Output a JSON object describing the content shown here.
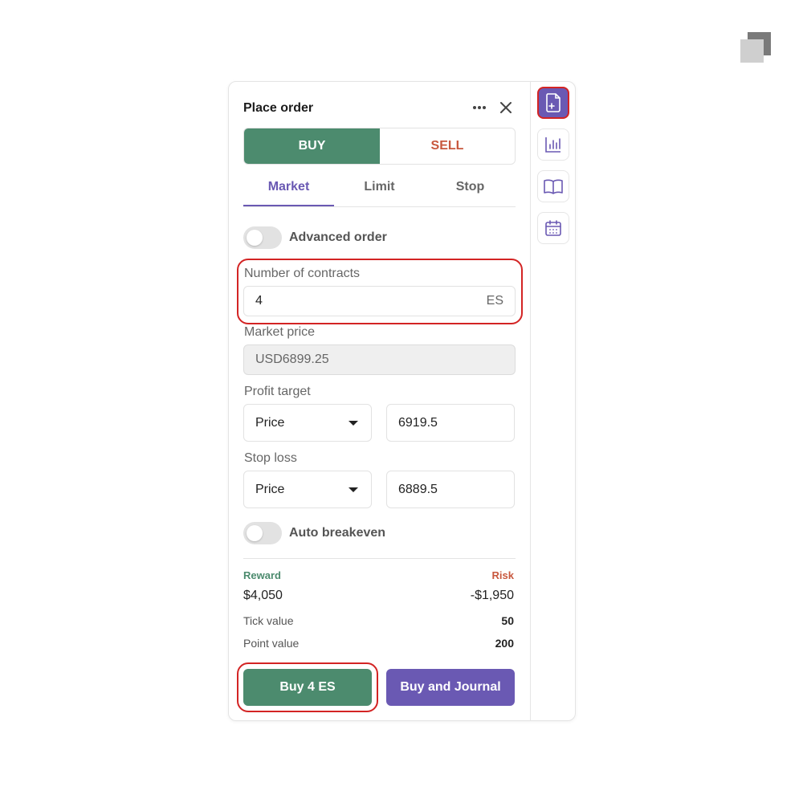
{
  "panel": {
    "title": "Place order"
  },
  "side_toggle": {
    "buy_label": "BUY",
    "sell_label": "SELL"
  },
  "order_tabs": [
    {
      "label": "Market",
      "active": true
    },
    {
      "label": "Limit",
      "active": false
    },
    {
      "label": "Stop",
      "active": false
    }
  ],
  "advanced_order": {
    "label": "Advanced order",
    "enabled": false
  },
  "contracts": {
    "label": "Number of contracts",
    "value": "4",
    "unit": "ES"
  },
  "market_price": {
    "label": "Market price",
    "value": "USD6899.25"
  },
  "profit_target": {
    "label": "Profit target",
    "type": "Price",
    "value": "6919.5"
  },
  "stop_loss": {
    "label": "Stop loss",
    "type": "Price",
    "value": "6889.5"
  },
  "auto_breakeven": {
    "label": "Auto breakeven",
    "enabled": false
  },
  "summary": {
    "reward_label": "Reward",
    "reward_value": "$4,050",
    "risk_label": "Risk",
    "risk_value": "-$1,950",
    "tick_label": "Tick value",
    "tick_value": "50",
    "point_label": "Point value",
    "point_value": "200"
  },
  "actions": {
    "buy_label": "Buy 4 ES",
    "journal_label": "Buy and Journal"
  },
  "side_icons": [
    {
      "name": "new-order-icon",
      "active": true
    },
    {
      "name": "chart-icon",
      "active": false
    },
    {
      "name": "journal-book-icon",
      "active": false
    },
    {
      "name": "calendar-icon",
      "active": false
    }
  ],
  "colors": {
    "buy_green": "#4c8b6e",
    "sell_red": "#c8583e",
    "accent_purple": "#6a59b3",
    "highlight_red": "#d32424"
  }
}
